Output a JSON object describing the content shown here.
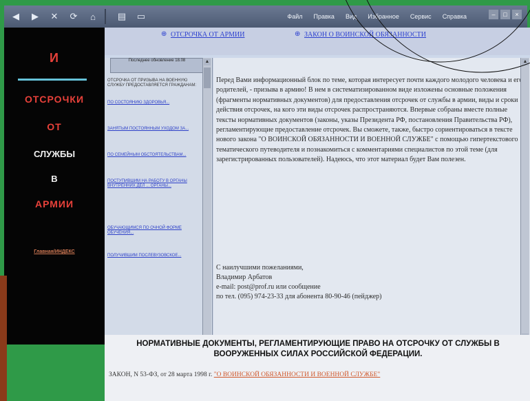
{
  "toolbar": {
    "menu": [
      "Файл",
      "Правка",
      "Вид",
      "Избранное",
      "Сервис",
      "Справка"
    ]
  },
  "left_panel": {
    "title_lines": [
      "И",
      "ОТСРОЧКИ",
      "ОТ",
      "СЛУЖБЫ",
      "В",
      "АРМИИ"
    ],
    "link": "Главная/ИНДЕКС"
  },
  "nav": {
    "link1": "ОТСРОЧКА ОТ АРМИИ",
    "link2": "ЗАКОН О ВОИНСКОЙ ОБЯЗАННОСТИ"
  },
  "list": {
    "header": "Последнее обновление 18.08",
    "intro": "ОТСРОЧКА ОТ ПРИЗЫВА НА ВОЕННУЮ СЛУЖБУ ПРЕДОСТАВЛЯЕТСЯ ГРАЖДАНАМ:",
    "items": [
      "ПО СОСТОЯНИЮ ЗДОРОВЬЯ...",
      "ЗАНЯТЫМ ПОСТОЯННЫМ УХОДОМ ЗА...",
      "ПО СЕМЕЙНЫМ ОБСТОЯТЕЛЬСТВАМ...",
      "ПОСТУПИВШИМ НА РАБОТУ В ОРГАНЫ ВНУТРЕННИХ ДЕЛ ... ОРГАНЫ...",
      "ОБУЧАЮЩИМСЯ ПО ОЧНОЙ ФОРМЕ ОБУЧЕНИЯ...",
      "ПОЛУЧИВШИМ ПОСЛЕВУЗОВСКОЕ..."
    ]
  },
  "content": {
    "paragraph": "Перед Вами информационный блок по теме, которая интересует почти каждого молодого человека и его родителей, - призыва в армию! В нем в систематизированном виде изложены основные положения (фрагменты нормативных документов) для предоставления отсрочек от службы в армии, виды и сроки действия отсрочек, на кого эти виды отсрочек распространяются. Впервые собраны вместе полные тексты нормативных документов (законы, указы Президента РФ, постановления Правительства РФ), регламентирующие предоставление отсрочек. Вы сможете, также, быстро сориентироваться в тексте нового закона \"О ВОИНСКОЙ ОБЯЗАННОСТИ И ВОЕННОЙ СЛУЖБЕ\" с помощью гипертекстового тематического путеводителя и познакомиться с комментариями специалистов по этой теме (для зарегистрированных пользователей). Надеюсь, что этот материал будет Вам полезен.",
    "signoff": "С наилучшими пожеланиями,",
    "name": "Владимир Арбатов",
    "email": "e-mail: post@prof.ru или сообщение",
    "phone": "по тел. (095) 974-23-33 для абонента 80-90-46 (пейджер)"
  },
  "bottom": {
    "heading": "НОРМАТИВНЫЕ ДОКУМЕНТЫ, РЕГЛАМЕНТИРУЮЩИЕ ПРАВО НА ОТСРОЧКУ ОТ СЛУЖБЫ В ВООРУЖЕННЫХ СИЛАХ РОССИЙСКОЙ ФЕДЕРАЦИИ.",
    "law_prefix": "ЗАКОН, N 53-ФЗ, от 28 марта 1998 г.",
    "law_link": "\"О ВОИНСКОЙ ОБЯЗАННОСТИ И ВОЕННОЙ СЛУЖБЕ\""
  },
  "colors": {
    "background": "#2f9a48",
    "link": "#2b3fcf",
    "title_red": "#e8413a"
  }
}
